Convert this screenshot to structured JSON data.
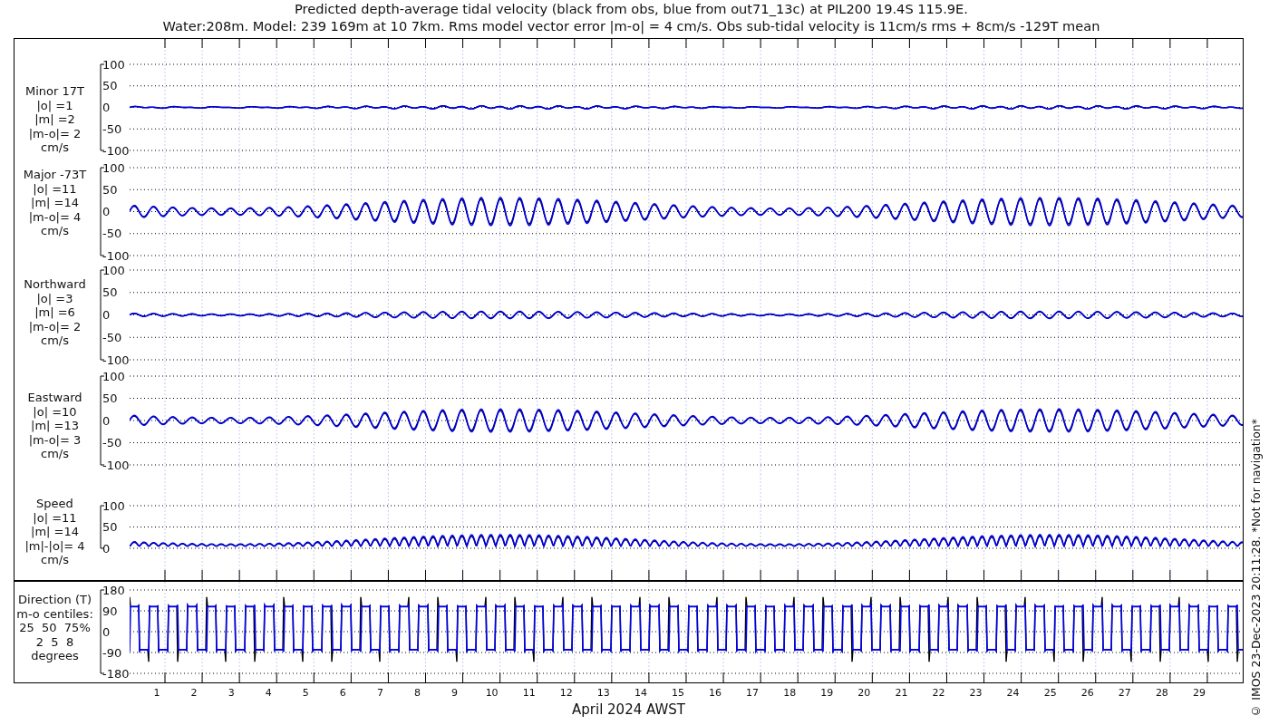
{
  "title": [
    "Predicted depth-average tidal velocity (black from obs, blue from out71_13c) at PIL200 19.4S 115.9E.",
    "Water:208m. Model: 239 169m at 10 7km. Rms model vector error |m-o| = 4 cm/s. Obs sub-tidal velocity is 11cm/s rms + 8cm/s -129T mean"
  ],
  "panels": [
    {
      "kind": "velocity",
      "label": [
        "Minor 17T",
        "|o| =1",
        "|m| =2",
        "|m-o|= 2",
        "cm/s"
      ],
      "yticks": [
        "100",
        "50",
        "0",
        "-50",
        "-100"
      ]
    },
    {
      "kind": "velocity",
      "label": [
        "Major -73T",
        "|o| =11",
        "|m| =14",
        "|m-o|= 4",
        "cm/s"
      ],
      "yticks": [
        "100",
        "50",
        "0",
        "-50",
        "-100"
      ]
    },
    {
      "kind": "velocity",
      "label": [
        "Northward",
        "|o| =3",
        "|m| =6",
        "|m-o|= 2",
        "cm/s"
      ],
      "yticks": [
        "100",
        "50",
        "0",
        "-50",
        "-100"
      ]
    },
    {
      "kind": "velocity",
      "label": [
        "Eastward",
        "|o| =10",
        "|m| =13",
        "|m-o|= 3",
        "cm/s"
      ],
      "yticks": [
        "100",
        "50",
        "0",
        "-50",
        "-100"
      ]
    },
    {
      "kind": "speed",
      "label": [
        "Speed",
        "|o| =11",
        "|m| =14",
        "|m|-|o|= 4",
        "cm/s"
      ],
      "yticks": [
        "100",
        "50",
        "0"
      ]
    },
    {
      "kind": "direction",
      "label": [
        "Direction (T)",
        "m-o centiles:",
        "25  50  75%",
        "2  5  8",
        "degrees"
      ],
      "yticks": [
        "180",
        "90",
        "0",
        "-90",
        "-180"
      ]
    }
  ],
  "x_axis": {
    "ticks": [
      "1",
      "2",
      "3",
      "4",
      "5",
      "6",
      "7",
      "8",
      "9",
      "10",
      "11",
      "12",
      "13",
      "14",
      "15",
      "16",
      "17",
      "18",
      "19",
      "20",
      "21",
      "22",
      "23",
      "24",
      "25",
      "26",
      "27",
      "28",
      "29"
    ],
    "label": "April 2024 AWST"
  },
  "footnote": "© IMOS 23-Dec-2023 20:11:28. *Not for navigation*"
}
